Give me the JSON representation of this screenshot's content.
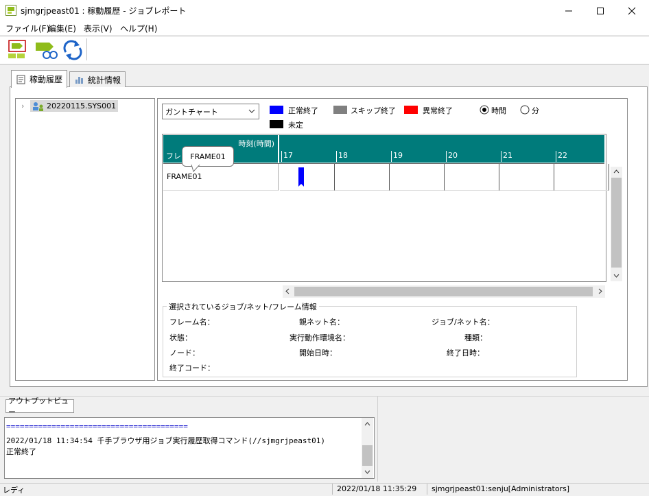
{
  "window": {
    "title": "sjmgrjpeast01 : 稼動履歴 - ジョブレポート"
  },
  "menu": [
    "ファイル(F)",
    "編集(E)",
    "表示(V)",
    "ヘルプ(H)"
  ],
  "tabs": [
    {
      "label": "稼動履歴"
    },
    {
      "label": "統計情報"
    }
  ],
  "tree": {
    "node": "20220115.SYS001"
  },
  "view": {
    "combo": "ガントチャート"
  },
  "legend": {
    "items": [
      {
        "label": "正常終了",
        "color": "#0000ff"
      },
      {
        "label": "スキップ終了",
        "color": "#808080"
      },
      {
        "label": "異常終了",
        "color": "#ff0000"
      },
      {
        "label": "未定",
        "color": "#000000"
      }
    ],
    "time_unit": [
      {
        "label": "時間",
        "selected": true
      },
      {
        "label": "分",
        "selected": false
      }
    ]
  },
  "gantt": {
    "header_time": "時刻(時間)",
    "header_frame": "フレー",
    "hours": [
      "17",
      "18",
      "19",
      "20",
      "21",
      "22"
    ],
    "row": "FRAME01",
    "tooltip": "FRAME01",
    "bar_color": "#0000ff"
  },
  "info": {
    "title": "選択されているジョブ/ネット/フレーム情報",
    "frame": "フレーム名：",
    "parent": "親ネット名：",
    "job": "ジョブ/ネット名：",
    "state": "状態：",
    "env": "実行動作環境名：",
    "kind": "種類：",
    "node": "ノード：",
    "start": "開始日時：",
    "end": "終了日時：",
    "code": "終了コード："
  },
  "output": {
    "header": "アウトプットビュー",
    "lines": [
      "========================================",
      "2022/01/18 11:34:54 千手ブラウザ用ジョブ実行履歴取得コマンド(//sjmgrjpeast01)",
      "正常終了"
    ]
  },
  "status": {
    "ready": "レディ",
    "datetime": "2022/01/18 11:35:29",
    "user": "sjmgrjpeast01:senju[Administrators]"
  }
}
